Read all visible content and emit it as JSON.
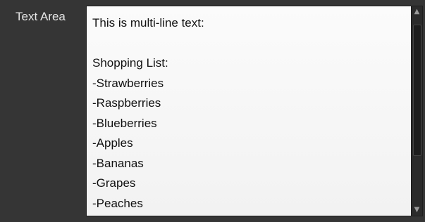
{
  "form": {
    "label": "Text Area",
    "textarea": {
      "value": "This is multi-line text:\n\nShopping List:\n-Strawberries\n-Raspberries\n-Blueberries\n-Apples\n-Bananas\n-Grapes\n-Peaches"
    },
    "scrollbar": {
      "up_icon": "chevron-up-icon",
      "down_icon": "chevron-down-icon"
    }
  }
}
